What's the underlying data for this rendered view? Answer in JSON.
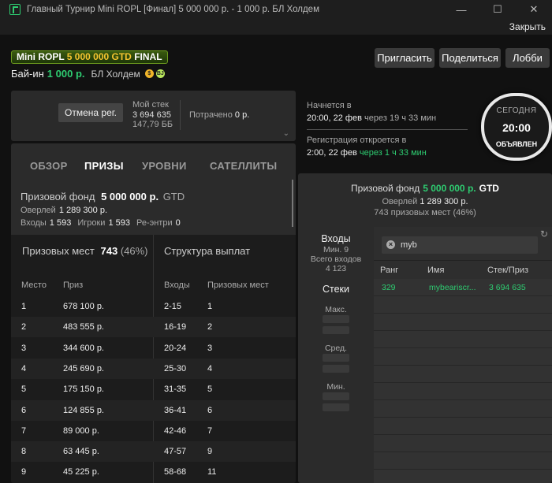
{
  "window": {
    "title": "Главный Турнир Mini ROPL [Финал] 5 000 000 р. - 1 000 р. БЛ Холдем",
    "close_label": "Закрыть"
  },
  "header": {
    "badge_name": "Mini ROPL",
    "badge_amount": "5 000 000 GTD",
    "badge_final": "FINAL",
    "buyin_label": "Бай-ин",
    "buyin_amount": "1 000 р.",
    "game": "БЛ Холдем",
    "coin1": "$",
    "coin2": "BJ",
    "buttons": {
      "invite": "Пригласить",
      "share": "Поделиться",
      "lobby": "Лобби"
    }
  },
  "registration": {
    "cancel_label": "Отмена рег.",
    "my_stack_label": "Мой стек",
    "my_stack_value": "3 694 635",
    "my_stack_bb": "147,79 ББ",
    "spent_label": "Потрачено",
    "spent_value": "0 р."
  },
  "timing": {
    "starts_label": "Начнется в",
    "starts_value": "20:00, 22 фев",
    "starts_rel": "через 19 ч 33 мин",
    "reg_label": "Регистрация откроется в",
    "reg_value": "2:00, 22 фев",
    "reg_rel": "через 1 ч 33 мин",
    "circle_day": "СЕГОДНЯ",
    "circle_time": "20:00",
    "circle_status": "ОБЪЯВЛЕН"
  },
  "tabs": [
    "ОБЗОР",
    "ПРИЗЫ",
    "УРОВНИ",
    "САТЕЛЛИТЫ"
  ],
  "prize_info": {
    "fund_label": "Призовой фонд",
    "fund_value": "5 000 000 р.",
    "gtd": "GTD",
    "overlay_label": "Оверлей",
    "overlay_value": "1 289 300 р.",
    "entries_label": "Входы",
    "entries_value": "1 593",
    "players_label": "Игроки",
    "players_value": "1 593",
    "reentries_label": "Ре-энтри",
    "reentries_value": "0"
  },
  "prizes_table": {
    "places_label": "Призовых мест",
    "places_value": "743",
    "places_pct": "(46%)",
    "structure_label": "Структура выплат",
    "col_place": "Место",
    "col_prize": "Приз",
    "col_entries": "Входы",
    "col_places": "Призовых мест",
    "rows": [
      {
        "place": "1",
        "prize": "678 100 р.",
        "entries": "2-15",
        "places": "1"
      },
      {
        "place": "2",
        "prize": "483 555 р.",
        "entries": "16-19",
        "places": "2"
      },
      {
        "place": "3",
        "prize": "344 600 р.",
        "entries": "20-24",
        "places": "3"
      },
      {
        "place": "4",
        "prize": "245 690 р.",
        "entries": "25-30",
        "places": "4"
      },
      {
        "place": "5",
        "prize": "175 150 р.",
        "entries": "31-35",
        "places": "5"
      },
      {
        "place": "6",
        "prize": "124 855 р.",
        "entries": "36-41",
        "places": "6"
      },
      {
        "place": "7",
        "prize": "89 000 р.",
        "entries": "42-46",
        "places": "7"
      },
      {
        "place": "8",
        "prize": "63 445 р.",
        "entries": "47-57",
        "places": "9"
      },
      {
        "place": "9",
        "prize": "45 225 р.",
        "entries": "58-68",
        "places": "11"
      }
    ]
  },
  "right_panel": {
    "fund_label": "Призовой фонд",
    "fund_value": "5 000 000 р.",
    "gtd": "GTD",
    "overlay": "Оверлей",
    "overlay_value": "1 289 300 р.",
    "places_line": "743 призовых мест (46%)",
    "entries_title": "Входы",
    "entries_min": "Мин. 9",
    "entries_total_label": "Всего входов",
    "entries_total": "4 123",
    "stacks_title": "Стеки",
    "stack_max": "Макс.",
    "stack_avg": "Сред.",
    "stack_min": "Мин.",
    "search_value": "myb",
    "col_rank": "Ранг",
    "col_name": "Имя",
    "col_stack": "Стек/Приз",
    "leaderboard": [
      {
        "rank": "329",
        "name": "mybeariscr...",
        "stack": "3 694 635"
      }
    ]
  }
}
